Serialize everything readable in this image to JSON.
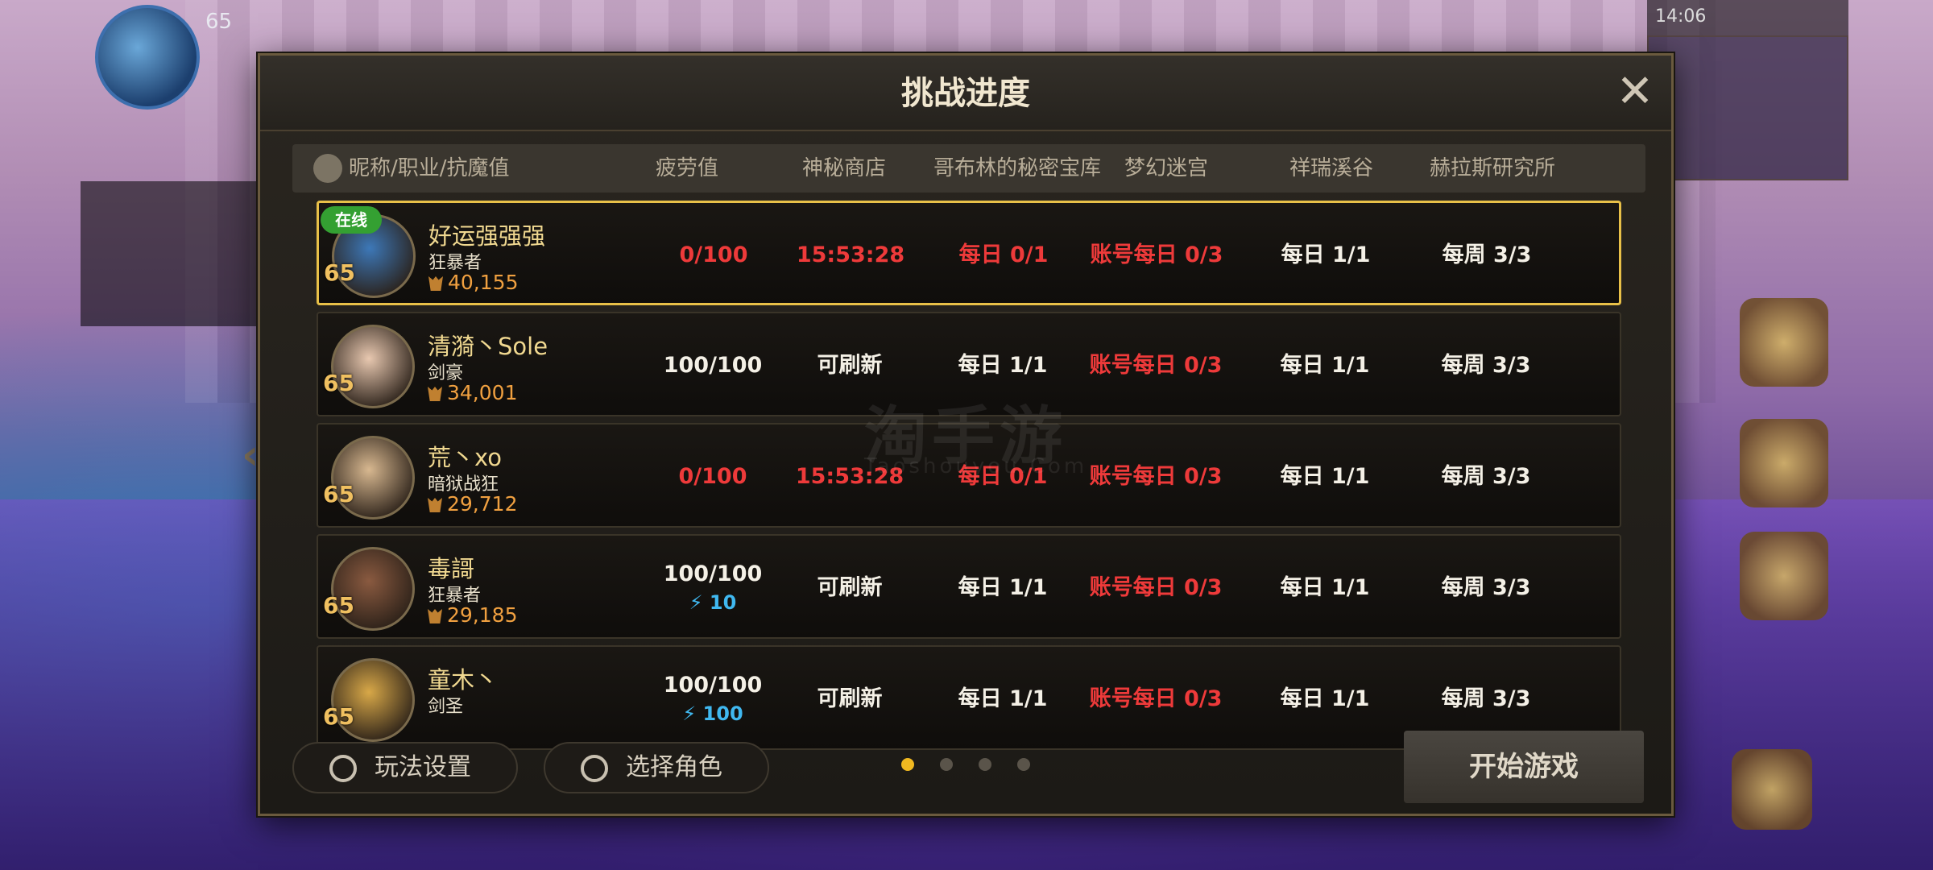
{
  "hud": {
    "player_level": "65",
    "status_time": "14:06"
  },
  "dialog": {
    "title": "挑战进度",
    "columns": [
      "昵称/职业/抗魔值",
      "疲劳值",
      "神秘商店",
      "哥布林的秘密宝库",
      "梦幻迷宫",
      "祥瑞溪谷",
      "赫拉斯研究所"
    ],
    "online_label": "在线",
    "rows": [
      {
        "name": "好运强强强",
        "job": "狂暴者",
        "level": "65",
        "power": "40,155",
        "fatigue": "0/100",
        "fatigue_red": true,
        "energy": "",
        "shop": "15:53:28",
        "shop_red": true,
        "goblin": "每日 0/1",
        "goblin_red": true,
        "maze": "账号每日 0/3",
        "valley": "每日 1/1",
        "hellas": "每周 3/3",
        "online": true,
        "avatar_color": "#3d78b8"
      },
      {
        "name": "清漪丶Sole",
        "job": "剑豪",
        "level": "65",
        "power": "34,001",
        "fatigue": "100/100",
        "fatigue_red": false,
        "energy": "",
        "shop": "可刷新",
        "shop_red": false,
        "goblin": "每日 1/1",
        "goblin_red": false,
        "maze": "账号每日 0/3",
        "valley": "每日 1/1",
        "hellas": "每周 3/3",
        "online": false,
        "avatar_color": "#e8c8b0"
      },
      {
        "name": "荒丶xo",
        "job": "暗狱战狂",
        "level": "65",
        "power": "29,712",
        "fatigue": "0/100",
        "fatigue_red": true,
        "energy": "",
        "shop": "15:53:28",
        "shop_red": true,
        "goblin": "每日 0/1",
        "goblin_red": true,
        "maze": "账号每日 0/3",
        "valley": "每日 1/1",
        "hellas": "每周 3/3",
        "online": false,
        "avatar_color": "#d8b890"
      },
      {
        "name": "毒謌",
        "job": "狂暴者",
        "level": "65",
        "power": "29,185",
        "fatigue": "100/100",
        "fatigue_red": false,
        "energy": "10",
        "shop": "可刷新",
        "shop_red": false,
        "goblin": "每日 1/1",
        "goblin_red": false,
        "maze": "账号每日 0/3",
        "valley": "每日 1/1",
        "hellas": "每周 3/3",
        "online": false,
        "avatar_color": "#8a5a40"
      },
      {
        "name": "童木丶",
        "job": "剑圣",
        "level": "65",
        "power": "",
        "fatigue": "100/100",
        "fatigue_red": false,
        "energy": "100",
        "shop": "可刷新",
        "shop_red": false,
        "goblin": "每日 1/1",
        "goblin_red": false,
        "maze": "账号每日 0/3",
        "valley": "每日 1/1",
        "hellas": "每周 3/3",
        "online": false,
        "avatar_color": "#d8a848"
      }
    ],
    "footer": {
      "settings_label": "玩法设置",
      "select_role_label": "选择角色",
      "start_label": "开始游戏",
      "page_count": 4,
      "current_page": 1
    }
  },
  "watermark": {
    "text": "淘手游",
    "sub": "Taoshouyou.Com"
  },
  "colors": {
    "accent_gold": "#e8c048",
    "warning_red": "#ee3a3a",
    "online_green": "#34a032",
    "energy_blue": "#40b8f0"
  }
}
